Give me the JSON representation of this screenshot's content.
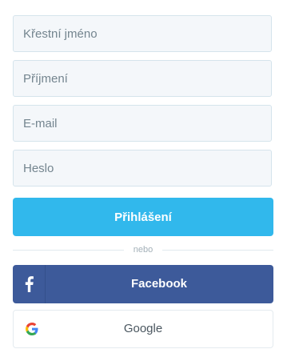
{
  "form": {
    "first_name": {
      "placeholder": "Křestní jméno",
      "value": ""
    },
    "last_name": {
      "placeholder": "Příjmení",
      "value": ""
    },
    "email": {
      "placeholder": "E-mail",
      "value": ""
    },
    "password": {
      "placeholder": "Heslo",
      "value": ""
    },
    "login_label": "Přihlášení",
    "divider_text": "nebo",
    "facebook_label": "Facebook",
    "google_label": "Google"
  },
  "icons": {
    "facebook": "facebook-f-icon",
    "google": "google-g-icon"
  },
  "colors": {
    "login_button": "#31b8ec",
    "facebook_button": "#3d5a9a",
    "field_background": "#f4f7fa",
    "field_border": "#d5e4ec"
  }
}
